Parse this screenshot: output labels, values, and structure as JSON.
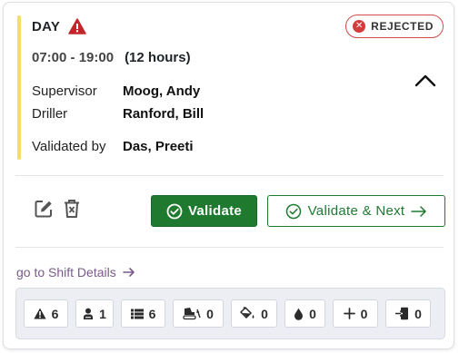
{
  "shift": {
    "name": "DAY",
    "time_range": "07:00 - 19:00",
    "duration": "(12 hours)"
  },
  "status": {
    "label": "REJECTED",
    "color": "#d23c3c"
  },
  "fields": [
    {
      "label": "Supervisor",
      "value": "Moog, Andy"
    },
    {
      "label": "Driller",
      "value": "Ranford, Bill"
    },
    {
      "label": "Validated by",
      "value": "Das, Preeti"
    }
  ],
  "actions": {
    "validate_label": "Validate",
    "validate_next_label": "Validate & Next",
    "primary_color": "#1f7a30"
  },
  "details_link": {
    "label": "go to Shift Details"
  },
  "stats": [
    {
      "icon": "warning-icon",
      "count": "6"
    },
    {
      "icon": "person-icon",
      "count": "1"
    },
    {
      "icon": "list-icon",
      "count": "6"
    },
    {
      "icon": "drill-rig-off-icon",
      "count": "0"
    },
    {
      "icon": "fuel-fill-icon",
      "count": "0"
    },
    {
      "icon": "water-drop-icon",
      "count": "0"
    },
    {
      "icon": "plus-icon",
      "count": "0"
    },
    {
      "icon": "entry-icon",
      "count": "0"
    }
  ],
  "accent_color": "#f4dd6b"
}
